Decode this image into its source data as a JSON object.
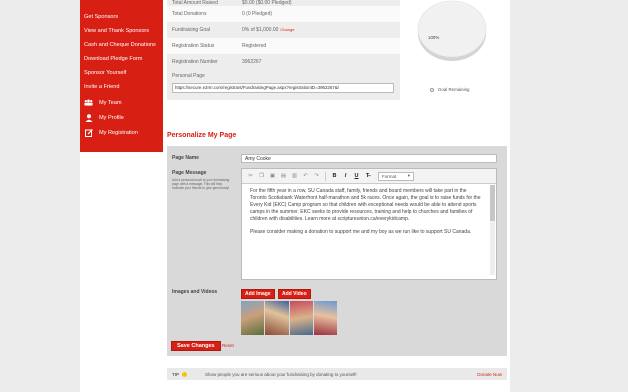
{
  "sidebar": {
    "items": [
      {
        "label": "Get Sponsors"
      },
      {
        "label": "View and Thank Sponsors"
      },
      {
        "label": "Cash and Cheque Donations"
      },
      {
        "label": "Download Pledge Form"
      },
      {
        "label": "Sponsor Yourself"
      },
      {
        "label": "Invite a Friend"
      }
    ],
    "icon_items": [
      {
        "label": "My Team",
        "icon": "team-icon"
      },
      {
        "label": "My Profile",
        "icon": "user-icon"
      },
      {
        "label": "My Registration",
        "icon": "edit-icon"
      }
    ]
  },
  "info": {
    "rows": [
      {
        "label": "Total Amount Raised",
        "value": "$0.00 ($0.00 Pledged)"
      },
      {
        "label": "Total Donations",
        "value": "0 (0 Pledged)"
      },
      {
        "label": "Fundraising Goal",
        "value": "0% of $1,000.00",
        "change": "Change"
      },
      {
        "label": "Registration Status",
        "value": "Registered"
      },
      {
        "label": "Registration Number",
        "value": "3962267"
      }
    ],
    "personal_page_label": "Personal Page",
    "personal_page_url": "https://secure.e2rm.com/registrant/FundraisingPage.aspx?registrationID=3962267&l"
  },
  "goal": {
    "percent_label": "100%",
    "legend": "Goal Remaining",
    "remaining_fraction": 1.0
  },
  "personalize": {
    "title": "Personalize My Page",
    "page_name_label": "Page Name",
    "page_name_value": "Amy Cooke",
    "page_message_label": "Page Message",
    "page_message_hint": "Add a personal touch to your fundraising page with a message. This will help motivate your friends to give generously!",
    "format_label": "Format",
    "message_paragraphs": [
      "For the fifth year in a row, SU Canada staff, family, friends and board members will take part in the Toronto Scotiabank Waterfront half-marathon and 5k races. Once again, the goal is to raise funds for the Every Kid (EKC) Camp program so that children with exceptional needs would be able to attend sports camps in the summer. EKC seeks to provide resources, training and help to churches and families of children with disabilities. Learn more at scriptureunion.ca/everykidcamp.",
      "Please consider making a donation to support me and my boy as we run like to support SU Canada."
    ],
    "images_label": "Images and Videos",
    "add_image": "Add Image",
    "add_video": "Add Video",
    "save": "Save Changes",
    "reset": "Reset"
  },
  "tip": {
    "label": "TIP",
    "text": "Show people you are serious about your fundraising by donating to yourself!",
    "donate": "Donate Now"
  },
  "colors": {
    "accent": "#d71f14",
    "panel": "#d9d9d9",
    "background": "#ececec"
  }
}
